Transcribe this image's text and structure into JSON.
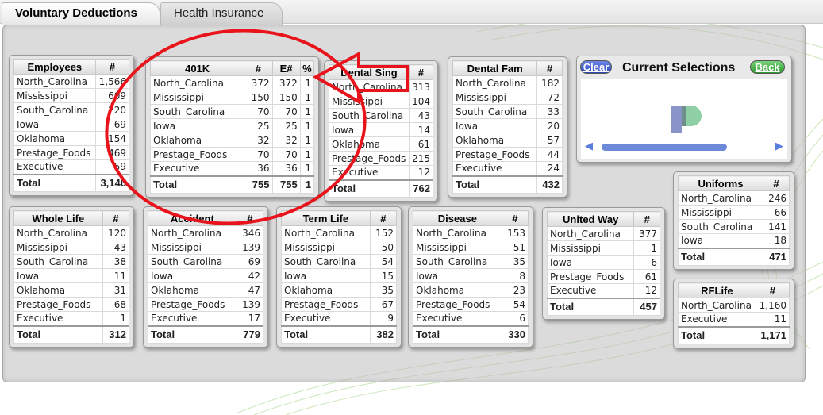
{
  "tabs": [
    {
      "label": "Voluntary Deductions"
    },
    {
      "label": "Health Insurance"
    }
  ],
  "current_selections": {
    "title": "Current Selections",
    "clear_label": "Clear",
    "back_label": "Back"
  },
  "boxes": {
    "employees": {
      "header": [
        "Employees",
        "#"
      ],
      "rows": [
        [
          "North_Carolina",
          "1,566"
        ],
        [
          "Mississippi",
          "609"
        ],
        [
          "South_Carolina",
          "220"
        ],
        [
          "Iowa",
          "69"
        ],
        [
          "Oklahoma",
          "154"
        ],
        [
          "Prestage_Foods",
          "469"
        ],
        [
          "Executive",
          "59"
        ]
      ],
      "total": [
        "Total",
        "3,146"
      ]
    },
    "k401": {
      "header": [
        "401K",
        "#",
        "E#",
        "%"
      ],
      "rows": [
        [
          "North_Carolina",
          "372",
          "372",
          "1"
        ],
        [
          "Mississippi",
          "150",
          "150",
          "1"
        ],
        [
          "South_Carolina",
          "70",
          "70",
          "1"
        ],
        [
          "Iowa",
          "25",
          "25",
          "1"
        ],
        [
          "Oklahoma",
          "32",
          "32",
          "1"
        ],
        [
          "Prestage_Foods",
          "70",
          "70",
          "1"
        ],
        [
          "Executive",
          "36",
          "36",
          "1"
        ]
      ],
      "total": [
        "Total",
        "755",
        "755",
        "1"
      ]
    },
    "dental_sing": {
      "header": [
        "Dental Sing",
        "#"
      ],
      "rows": [
        [
          "North_Carolina",
          "313"
        ],
        [
          "Mississippi",
          "104"
        ],
        [
          "South_Carolina",
          "43"
        ],
        [
          "Iowa",
          "14"
        ],
        [
          "Oklahoma",
          "61"
        ],
        [
          "Prestage_Foods",
          "215"
        ],
        [
          "Executive",
          "12"
        ]
      ],
      "total": [
        "Total",
        "762"
      ]
    },
    "dental_fam": {
      "header": [
        "Dental Fam",
        "#"
      ],
      "rows": [
        [
          "North_Carolina",
          "182"
        ],
        [
          "Mississippi",
          "72"
        ],
        [
          "South_Carolina",
          "33"
        ],
        [
          "Iowa",
          "20"
        ],
        [
          "Oklahoma",
          "57"
        ],
        [
          "Prestage_Foods",
          "44"
        ],
        [
          "Executive",
          "24"
        ]
      ],
      "total": [
        "Total",
        "432"
      ]
    },
    "uniforms": {
      "header": [
        "Uniforms",
        "#"
      ],
      "rows": [
        [
          "North_Carolina",
          "246"
        ],
        [
          "Mississippi",
          "66"
        ],
        [
          "South_Carolina",
          "141"
        ],
        [
          "Iowa",
          "18"
        ]
      ],
      "total": [
        "Total",
        "471"
      ]
    },
    "whole_life": {
      "header": [
        "Whole Life",
        "#"
      ],
      "rows": [
        [
          "North_Carolina",
          "120"
        ],
        [
          "Mississippi",
          "43"
        ],
        [
          "South_Carolina",
          "38"
        ],
        [
          "Iowa",
          "11"
        ],
        [
          "Oklahoma",
          "31"
        ],
        [
          "Prestage_Foods",
          "68"
        ],
        [
          "Executive",
          "1"
        ]
      ],
      "total": [
        "Total",
        "312"
      ]
    },
    "accident": {
      "header": [
        "Accident",
        "#"
      ],
      "rows": [
        [
          "North_Carolina",
          "346"
        ],
        [
          "Mississippi",
          "139"
        ],
        [
          "South_Carolina",
          "69"
        ],
        [
          "Iowa",
          "42"
        ],
        [
          "Oklahoma",
          "47"
        ],
        [
          "Prestage_Foods",
          "139"
        ],
        [
          "Executive",
          "17"
        ]
      ],
      "total": [
        "Total",
        "779"
      ]
    },
    "term_life": {
      "header": [
        "Term Life",
        "#"
      ],
      "rows": [
        [
          "North_Carolina",
          "152"
        ],
        [
          "Mississippi",
          "50"
        ],
        [
          "South_Carolina",
          "54"
        ],
        [
          "Iowa",
          "15"
        ],
        [
          "Oklahoma",
          "35"
        ],
        [
          "Prestage_Foods",
          "67"
        ],
        [
          "Executive",
          "9"
        ]
      ],
      "total": [
        "Total",
        "382"
      ]
    },
    "disease": {
      "header": [
        "Disease",
        "#"
      ],
      "rows": [
        [
          "North_Carolina",
          "153"
        ],
        [
          "Mississippi",
          "51"
        ],
        [
          "South_Carolina",
          "35"
        ],
        [
          "Iowa",
          "8"
        ],
        [
          "Oklahoma",
          "23"
        ],
        [
          "Prestage_Foods",
          "54"
        ],
        [
          "Executive",
          "6"
        ]
      ],
      "total": [
        "Total",
        "330"
      ]
    },
    "united_way": {
      "header": [
        "United Way",
        "#"
      ],
      "rows": [
        [
          "North_Carolina",
          "377"
        ],
        [
          "Mississippi",
          "1"
        ],
        [
          "Iowa",
          "6"
        ],
        [
          "Prestage_Foods",
          "61"
        ],
        [
          "Executive",
          "12"
        ]
      ],
      "total": [
        "Total",
        "457"
      ]
    },
    "rflife": {
      "header": [
        "RFLife",
        "#"
      ],
      "rows": [
        [
          "North_Carolina",
          "1,160"
        ],
        [
          "Executive",
          "11"
        ]
      ],
      "total": [
        "Total",
        "1,171"
      ]
    }
  },
  "colors": {
    "annotation": "#e8131b",
    "clear_button": "#3451c7",
    "back_button": "#3aa53a",
    "scrollbar": "#6d8ad9"
  },
  "icons": [
    "swirl-background",
    "qlik-logo-icon",
    "scroll-left-icon",
    "scroll-right-icon"
  ]
}
